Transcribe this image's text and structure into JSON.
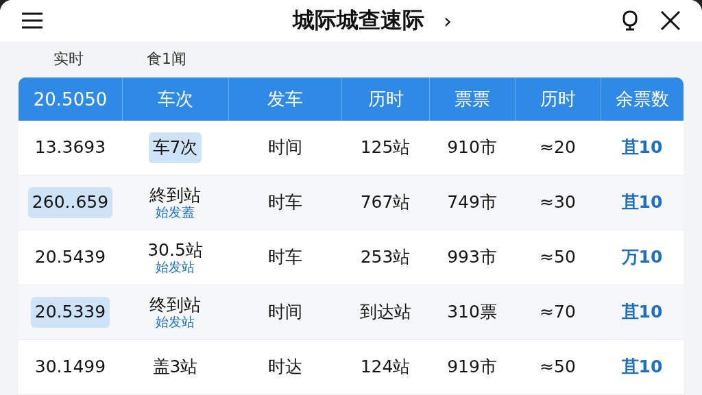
{
  "header": {
    "title": "城际城查速际",
    "next": "›"
  },
  "tabs": [
    {
      "label": "实时",
      "selected": false
    },
    {
      "label": "食1闻",
      "selected": false
    }
  ],
  "table": {
    "columns": [
      "20.5050",
      "车次",
      "发车",
      "历时",
      "票票",
      "历时",
      "余票数"
    ],
    "rows": [
      {
        "cells": [
          {
            "text": "13.3693",
            "highlighted": false
          },
          {
            "text": "车7次",
            "highlighted": true
          },
          {
            "text": "时间"
          },
          {
            "text": "125站"
          },
          {
            "text": "910市"
          },
          {
            "text": "≈20"
          },
          {
            "text": "苴10"
          }
        ]
      },
      {
        "cells": [
          {
            "text": "260..659",
            "highlighted": true
          },
          {
            "text": "終到站",
            "sub": "始发蓋",
            "highlighted": false
          },
          {
            "text": "时车"
          },
          {
            "text": "767站"
          },
          {
            "text": "749市"
          },
          {
            "text": "≈30"
          },
          {
            "text": "苴10"
          }
        ]
      },
      {
        "cells": [
          {
            "text": "20.5439",
            "highlighted": false
          },
          {
            "text": "30.5站",
            "sub": "始发站",
            "highlighted": false
          },
          {
            "text": "时车"
          },
          {
            "text": "253站"
          },
          {
            "text": "993市"
          },
          {
            "text": "≈50"
          },
          {
            "text": "万10"
          }
        ]
      },
      {
        "cells": [
          {
            "text": "20.5339",
            "highlighted": true
          },
          {
            "text": "终到站",
            "sub": "始发站",
            "highlighted": false
          },
          {
            "text": "时间"
          },
          {
            "text": "到达站"
          },
          {
            "text": "310票"
          },
          {
            "text": "≈70"
          },
          {
            "text": "苴10"
          }
        ]
      },
      {
        "cells": [
          {
            "text": "30.1499",
            "highlighted": false
          },
          {
            "text": "盖3站",
            "highlighted": false
          },
          {
            "text": "时达"
          },
          {
            "text": "124站"
          },
          {
            "text": "919市"
          },
          {
            "text": "≈50"
          },
          {
            "text": "苴10"
          }
        ]
      }
    ]
  }
}
